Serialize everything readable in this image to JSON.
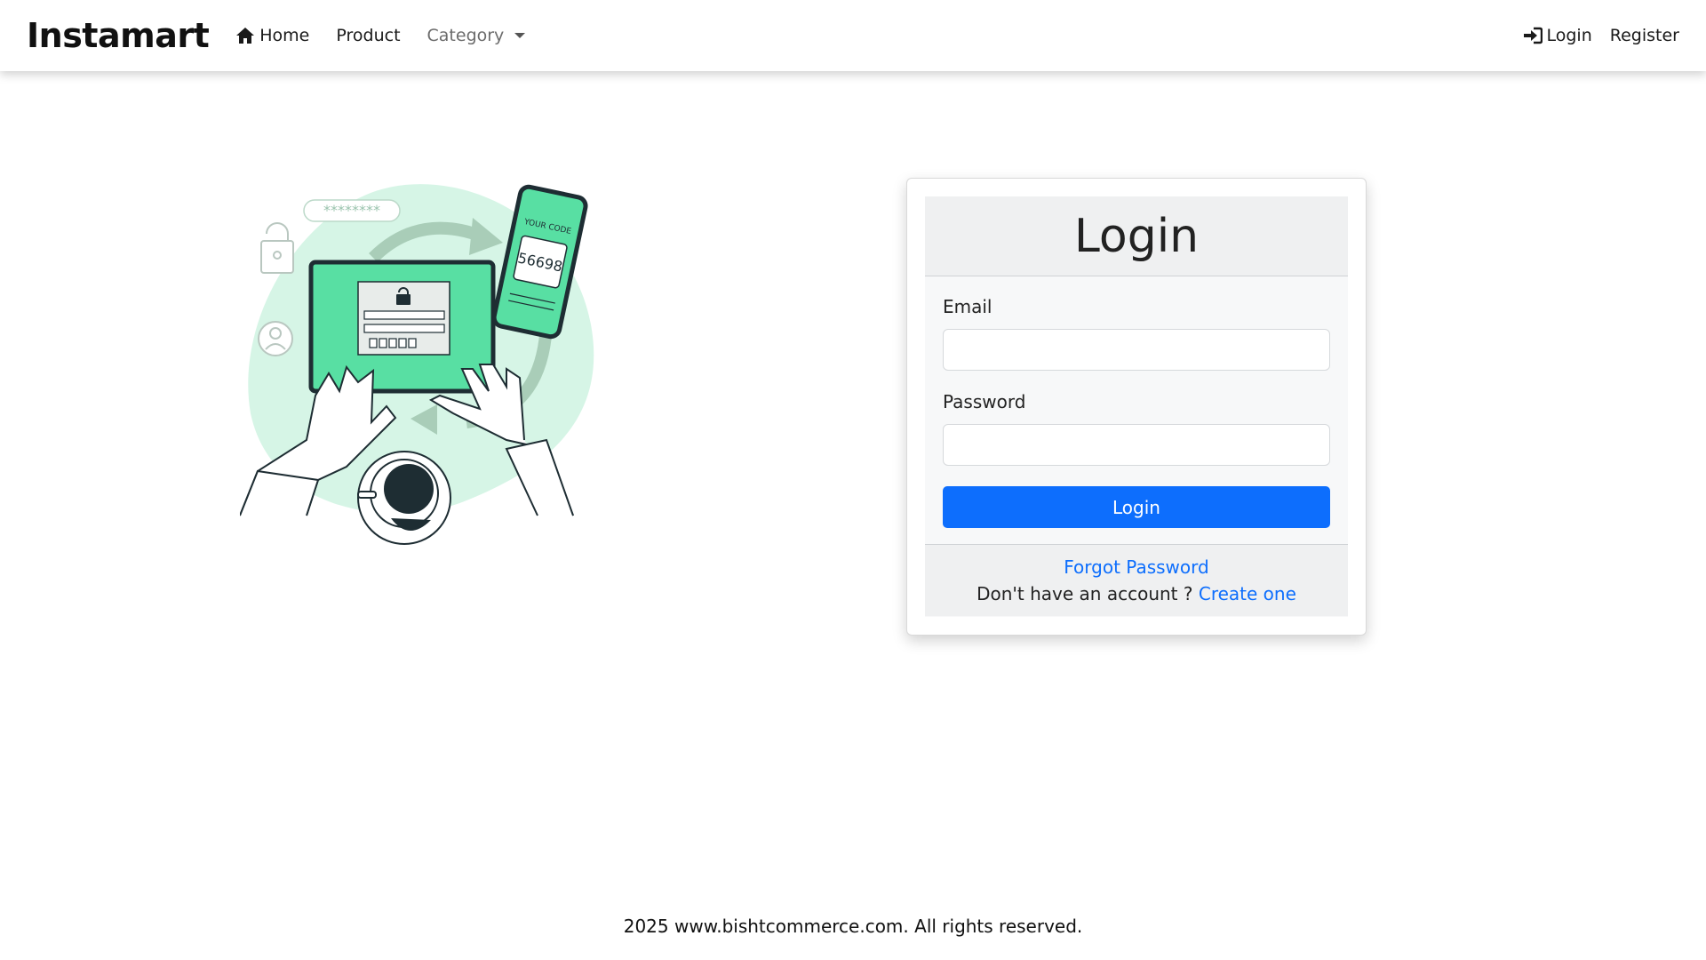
{
  "navbar": {
    "brand": "Instamart",
    "home_label": "Home",
    "product_label": "Product",
    "category_label": "Category",
    "login_label": "Login",
    "register_label": "Register"
  },
  "illustration": {
    "password_mask": "********",
    "phone_caption": "YOUR CODE",
    "phone_code": "56698",
    "palette": {
      "green": "#58dfa3",
      "light_green": "#d6f5e6",
      "dark": "#1e2d33"
    }
  },
  "login_card": {
    "title": "Login",
    "email_label": "Email",
    "email_value": "",
    "password_label": "Password",
    "password_value": "",
    "submit_label": "Login",
    "forgot_password": "Forgot Password",
    "no_account_text": "Don't have an account ?",
    "create_one": "Create one"
  },
  "footer": {
    "copyright": "2025 www.bishtcommerce.com. All rights reserved."
  },
  "colors": {
    "primary": "#0d6efd",
    "navbar_bg": "#ffffff",
    "card_header_bg": "#eff0f1"
  }
}
